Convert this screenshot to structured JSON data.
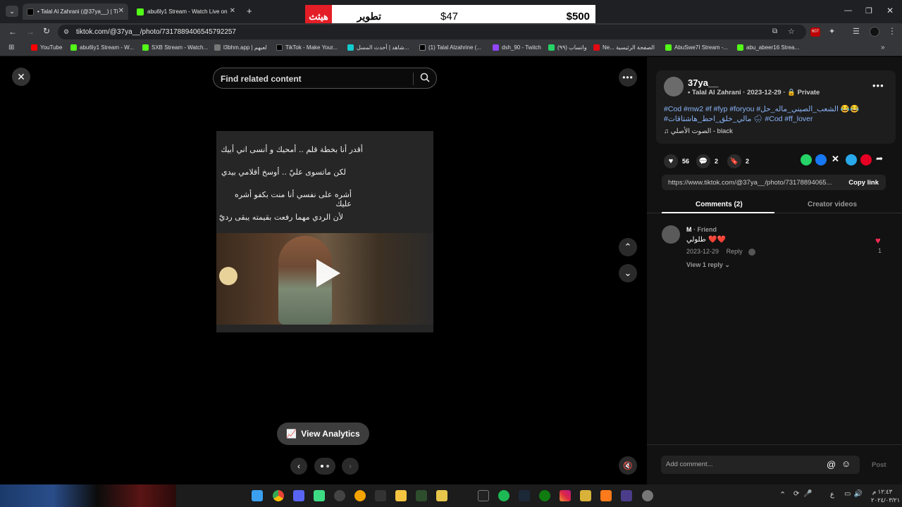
{
  "browser": {
    "tabs": [
      {
        "title": "• Talal Al Zahrani (@37ya__) | Ti",
        "active": true
      },
      {
        "title": "abu6ly1 Stream - Watch Live on",
        "active": false
      }
    ],
    "new_tab": "+",
    "url": "tiktok.com/@37ya__/photo/7317889406545792257",
    "bookmarks": [
      "YouTube",
      "abu6ly1 Stream - W...",
      "SXB Stream - Watch...",
      "l3bhm.app | لعبهم",
      "TikTok - Make Your...",
      "شاهد | أحدث المسل...",
      "(1) Talal Alzahrine (...",
      "dsh_90 - Twitch",
      "(٩٩) واتساب",
      "Ne... الصفحة الرئيسية",
      "AbuSwe7I Stream -...",
      "abu_abeer16 Strea..."
    ],
    "extension_badge": "607"
  },
  "ad": {
    "red_text": "هيثث",
    "title": "تطوير",
    "price_left": "$47",
    "price_right": "$500"
  },
  "viewer": {
    "search_placeholder": "Find related content",
    "lines": [
      "أقدر أنا بخطة قلم .. أمحيك و أنسى اني أبيك",
      "لكن ماتسوى عليّ .. أوسخ أقلامي بيدي",
      "أشره على نفسي أنا منت بكفو أشره عليك",
      "لأن الردي مهما رفعت بقيمته يبقى رديّ"
    ],
    "view_analytics": "View Analytics"
  },
  "post": {
    "username": "37ya__",
    "display_name": "Talal Al Zahrani",
    "date": "2023-12-29",
    "privacy": "Private",
    "caption_line1": "#Cod #mw2 #f #fyp #foryou #الشعب_الصيني_ماله_حل 😂😂",
    "caption_line2": "#مالي_خلق_احط_هاشتاقات 🌧 #Cod #ff_lover",
    "sound": "الصوت الأصلي - black",
    "likes": "56",
    "comments": "2",
    "saves": "2",
    "link": "https://www.tiktok.com/@37ya__/photo/73178894065...",
    "copy_link": "Copy link",
    "tab_comments": "Comments (2)",
    "tab_creator": "Creator videos"
  },
  "comment": {
    "author": "M",
    "badge": "· Friend",
    "text": "طلولي ❤️❤️",
    "date": "2023-12-29",
    "reply": "Reply",
    "view_replies": "View 1 reply",
    "like_count": "1"
  },
  "composer": {
    "placeholder": "Add comment...",
    "post": "Post"
  },
  "taskbar": {
    "time": "١٢:٤٣ م",
    "date": "٢٠٢٤/٠٣/٢١",
    "lang": "ع"
  },
  "colors": {
    "accent": "#fe2c55",
    "chrome_bg": "#35363a",
    "link": "#8ab4f8"
  }
}
